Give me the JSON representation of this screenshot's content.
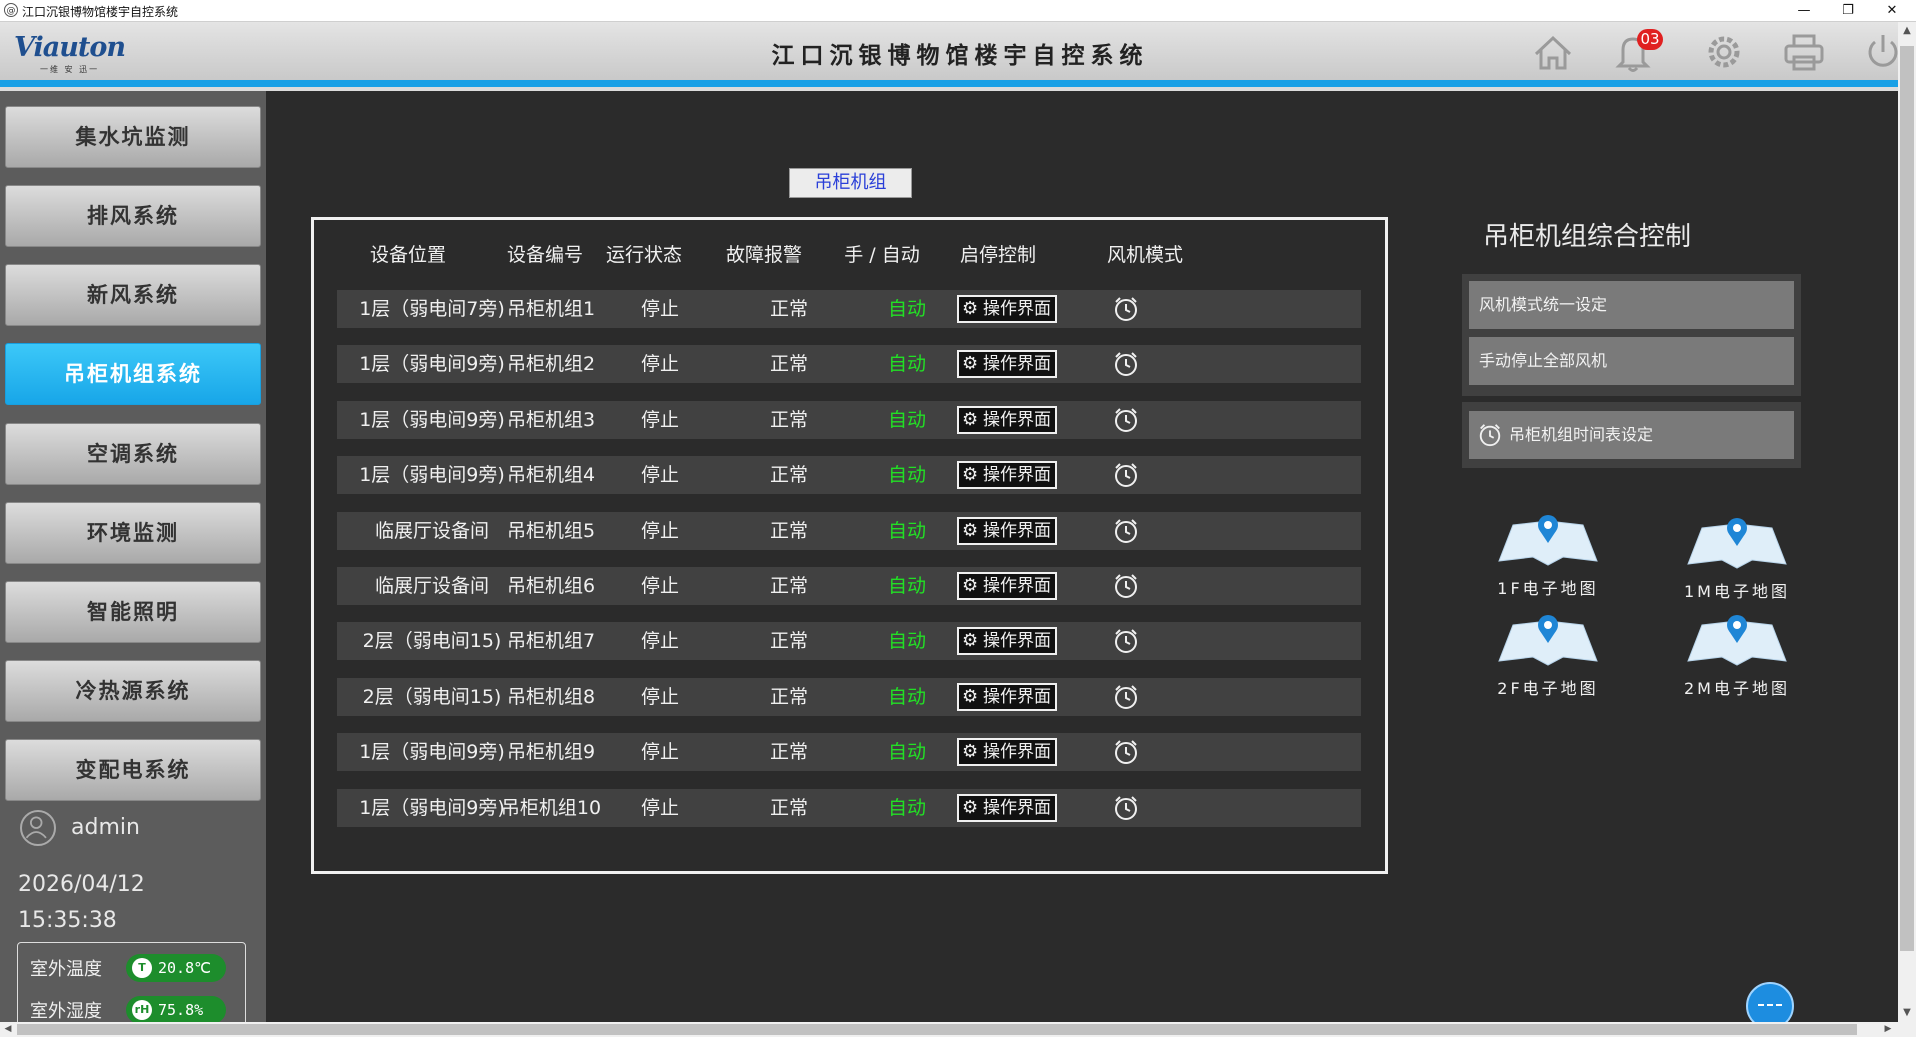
{
  "window": {
    "title": "江口沉银博物馆楼宇自控系统",
    "controls": {
      "minimize": "—",
      "restore": "❐",
      "close": "✕"
    }
  },
  "header": {
    "logo": "Viauton",
    "logo_sub": "一维 安 迅一",
    "title": "江口沉银博物馆楼宇自控系统",
    "icons": [
      "home-icon",
      "bell-icon",
      "gear-icon",
      "printer-icon",
      "power-icon"
    ],
    "notification_count": "03",
    "accent_color": "#19a0e6"
  },
  "sidebar": {
    "items": [
      {
        "label": "集水坑监测",
        "active": false
      },
      {
        "label": "排风系统",
        "active": false
      },
      {
        "label": "新风系统",
        "active": false
      },
      {
        "label": "吊柜机组系统",
        "active": true
      },
      {
        "label": "空调系统",
        "active": false
      },
      {
        "label": "环境监测",
        "active": false
      },
      {
        "label": "智能照明",
        "active": false
      },
      {
        "label": "冷热源系统",
        "active": false
      },
      {
        "label": "变配电系统",
        "active": false
      }
    ],
    "user": "admin",
    "date": "2026/04/12",
    "time": "15:35:38",
    "env": {
      "temp_label": "室外温度",
      "temp_value": "20.8℃",
      "humidity_label": "室外湿度",
      "humidity_value": "75.8%"
    }
  },
  "main": {
    "group_tag": "吊柜机组",
    "columns": [
      "设备位置",
      "设备编号",
      "运行状态",
      "故障报警",
      "手 / 自动",
      "启停控制",
      "风机模式"
    ],
    "rows": [
      {
        "location": "1层（弱电间7旁)",
        "id": "吊柜机组1",
        "status": "停止",
        "alarm": "正常",
        "mode": "自动",
        "control": "操作界面"
      },
      {
        "location": "1层（弱电间9旁)",
        "id": "吊柜机组2",
        "status": "停止",
        "alarm": "正常",
        "mode": "自动",
        "control": "操作界面"
      },
      {
        "location": "1层（弱电间9旁)",
        "id": "吊柜机组3",
        "status": "停止",
        "alarm": "正常",
        "mode": "自动",
        "control": "操作界面"
      },
      {
        "location": "1层（弱电间9旁)",
        "id": "吊柜机组4",
        "status": "停止",
        "alarm": "正常",
        "mode": "自动",
        "control": "操作界面"
      },
      {
        "location": "临展厅设备间",
        "id": "吊柜机组5",
        "status": "停止",
        "alarm": "正常",
        "mode": "自动",
        "control": "操作界面"
      },
      {
        "location": "临展厅设备间",
        "id": "吊柜机组6",
        "status": "停止",
        "alarm": "正常",
        "mode": "自动",
        "control": "操作界面"
      },
      {
        "location": "2层（弱电间15)",
        "id": "吊柜机组7",
        "status": "停止",
        "alarm": "正常",
        "mode": "自动",
        "control": "操作界面"
      },
      {
        "location": "2层（弱电间15)",
        "id": "吊柜机组8",
        "status": "停止",
        "alarm": "正常",
        "mode": "自动",
        "control": "操作界面"
      },
      {
        "location": "1层（弱电间9旁)",
        "id": "吊柜机组9",
        "status": "停止",
        "alarm": "正常",
        "mode": "自动",
        "control": "操作界面"
      },
      {
        "location": "1层（弱电间9旁)",
        "id": "吊柜机组10",
        "status": "停止",
        "alarm": "正常",
        "mode": "自动",
        "control": "操作界面"
      }
    ],
    "status_colors": {
      "auto": "#22e025",
      "text": "#f0f0f0"
    }
  },
  "control": {
    "title": "吊柜机组综合控制",
    "btn_mode_unify": "风机模式统一设定",
    "btn_stop_all": "手动停止全部风机",
    "btn_schedule": "吊柜机组时间表设定"
  },
  "maps": [
    "1F电子地图",
    "1M电子地图",
    "2F电子地图",
    "2M电子地图"
  ]
}
